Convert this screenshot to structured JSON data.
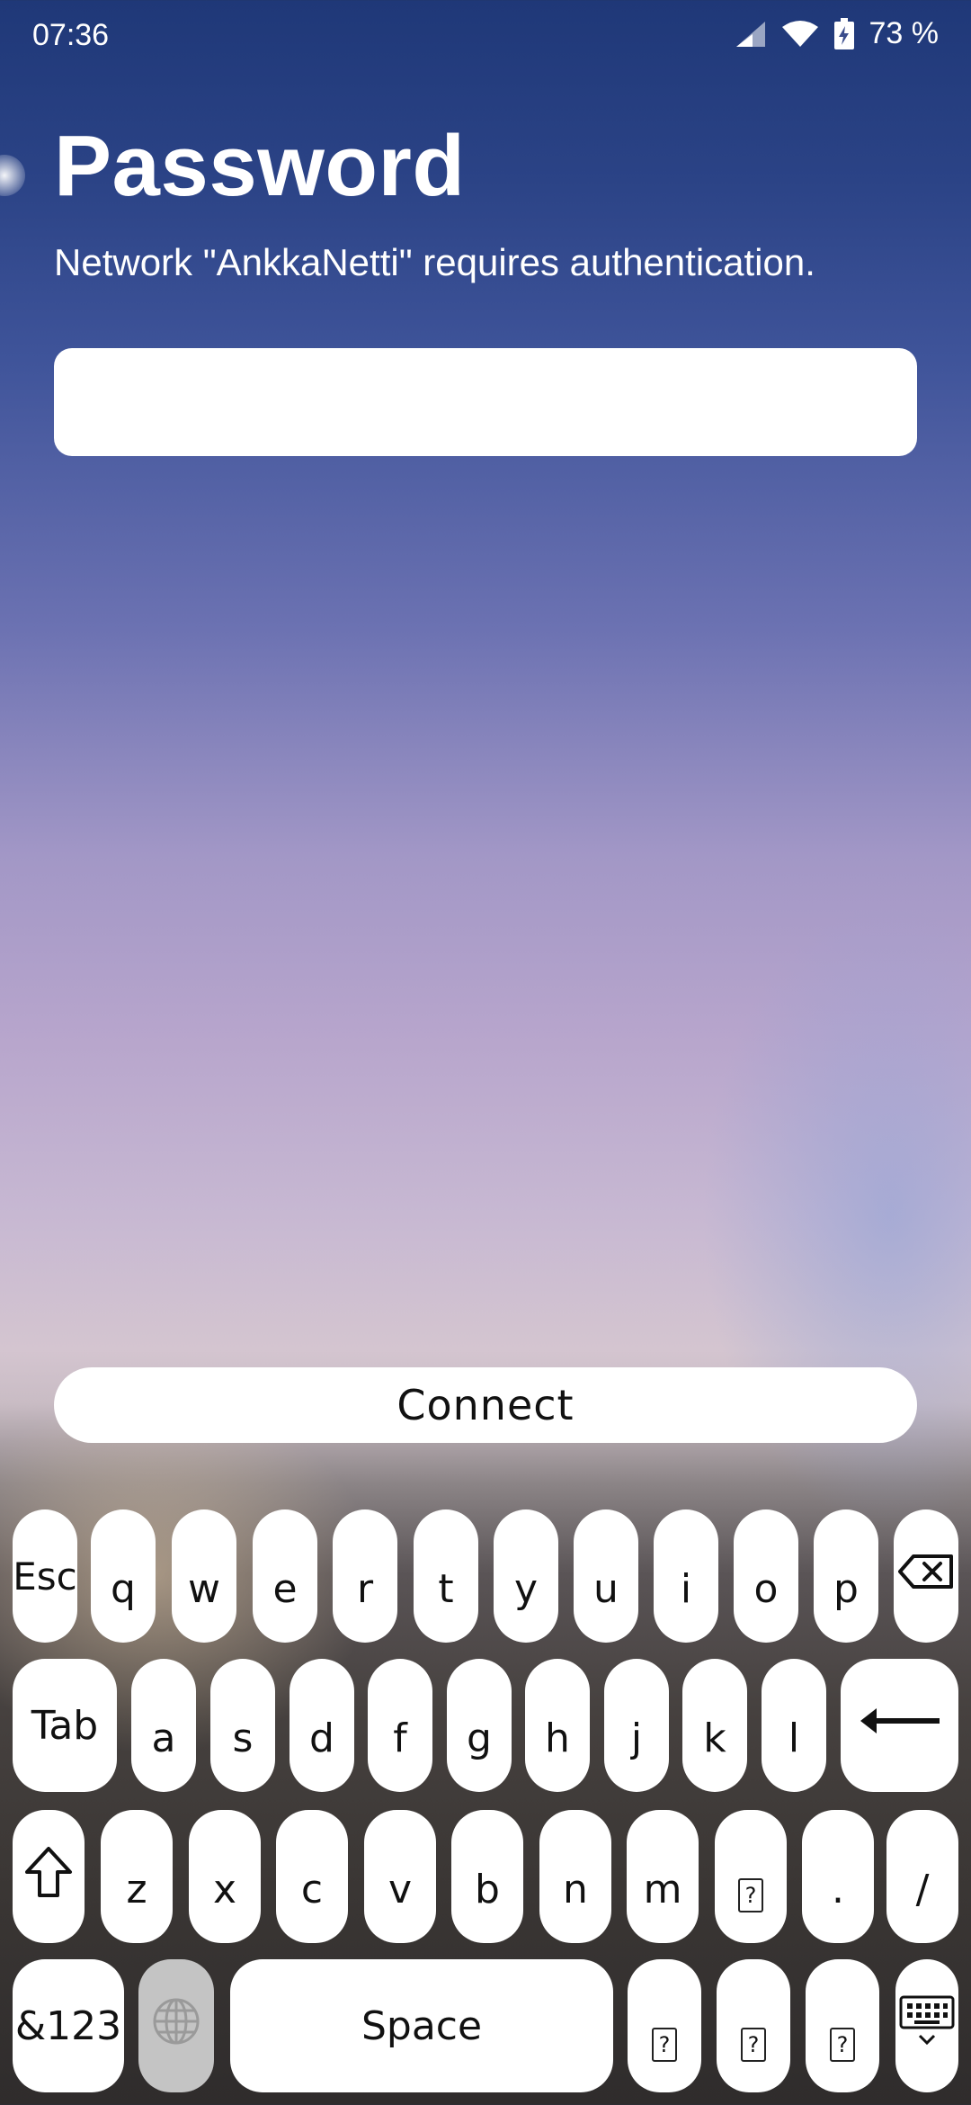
{
  "status_bar": {
    "time": "07:36",
    "battery": "73 %"
  },
  "dialog": {
    "title": "Password",
    "message": "Network \"AnkkaNetti\" requires authentication.",
    "password_value": "",
    "connect_label": "Connect"
  },
  "keyboard": {
    "row1": [
      "Esc",
      "q",
      "w",
      "e",
      "r",
      "t",
      "y",
      "u",
      "i",
      "o",
      "p"
    ],
    "row2": [
      "Tab",
      "a",
      "s",
      "d",
      "f",
      "g",
      "h",
      "j",
      "k",
      "l"
    ],
    "row3": [
      "z",
      "x",
      "c",
      "v",
      "b",
      "n",
      "m",
      "?",
      ".",
      "/"
    ],
    "row4_left": "&123",
    "space_label": "Space",
    "row4_unknown": [
      "?",
      "?",
      "?"
    ]
  },
  "icons": {
    "backspace": "backspace-icon",
    "enter": "enter-icon",
    "shift": "shift-icon",
    "globe": "globe-icon",
    "hide_keyboard": "keyboard-hide-icon",
    "signal": "signal-icon",
    "wifi": "wifi-icon",
    "battery": "battery-charging-icon"
  }
}
